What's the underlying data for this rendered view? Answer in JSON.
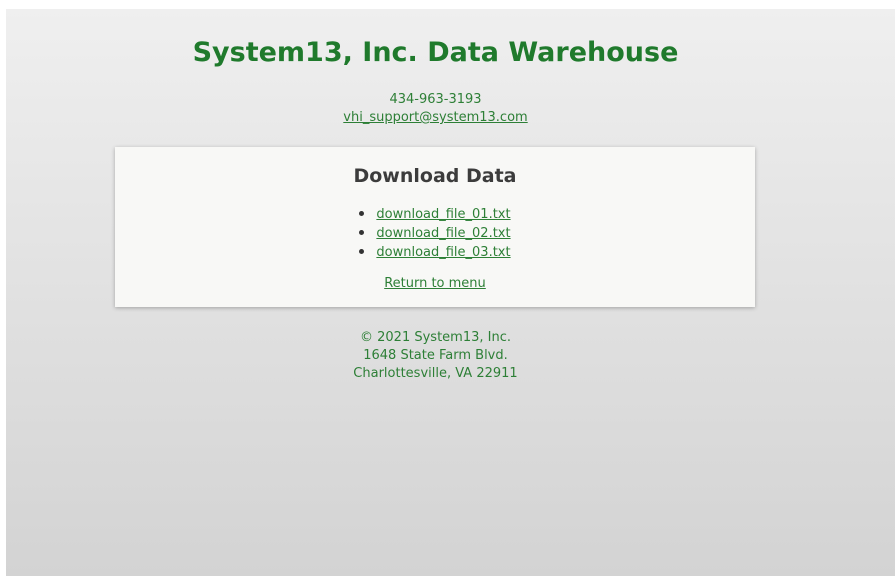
{
  "header": {
    "title": "System13, Inc. Data Warehouse",
    "phone": "434-963-3193",
    "email": "vhi_support@system13.com"
  },
  "panel": {
    "title": "Download Data",
    "files": [
      {
        "label": "download_file_01.txt"
      },
      {
        "label": "download_file_02.txt"
      },
      {
        "label": "download_file_03.txt"
      }
    ],
    "return_label": "Return to menu"
  },
  "footer": {
    "copyright": "© 2021 System13, Inc.",
    "address_line1": "1648 State Farm Blvd.",
    "address_line2": "Charlottesville, VA 22911"
  },
  "colors": {
    "accent": "#1f7a2c",
    "link": "#2d7f36",
    "panel_bg": "#f8f8f6",
    "heading": "#3c3c3c"
  }
}
